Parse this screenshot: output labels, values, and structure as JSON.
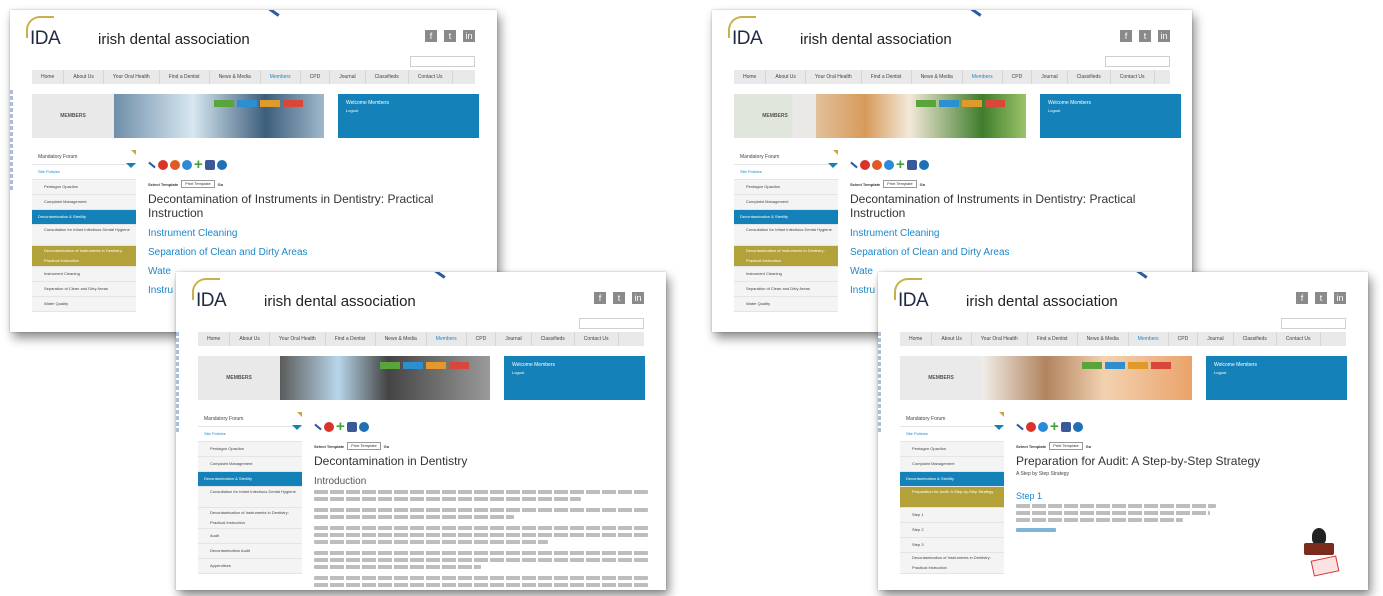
{
  "screens": [
    {
      "logo": "IDA",
      "site_name": "irish dental association",
      "nav": [
        "Home",
        "About Us",
        "Your Oral Health",
        "Find a Dentist",
        "News & Media",
        "Members",
        "CPD",
        "Journal",
        "Classifieds",
        "Contact Us"
      ],
      "banner_label": "MEMBERS",
      "welcome": "Welcome Members",
      "welcome_sub": "Logout",
      "sidebar": [
        "Mandatory Forum",
        "Site Policies",
        "Pentagon Opaclion",
        "Complaint Management",
        "Decontamination & Sterility",
        "Consultation for Infant Infectious Dental Hygiene",
        "Decontamination of Instruments in Dentistry: Practical Instruction",
        "Instrument Cleaning",
        "Separation of Clean and Dirty Areas",
        "Water Quality"
      ],
      "select_label": "Select Template",
      "select_value": "Print Template",
      "select_go": "Go",
      "title": "Decontamination of Instruments in Dentistry: Practical Instruction",
      "links": [
        "Instrument Cleaning",
        "Separation of Clean and Dirty Areas",
        "Wate",
        "Instru"
      ]
    },
    {
      "logo": "IDA",
      "site_name": "irish dental association",
      "nav": [
        "Home",
        "About Us",
        "Your Oral Health",
        "Find a Dentist",
        "News & Media",
        "Members",
        "CPD",
        "Journal",
        "Classifieds",
        "Contact Us"
      ],
      "banner_label": "MEMBERS",
      "welcome": "Welcome Members",
      "welcome_sub": "Logout",
      "sidebar": [
        "Mandatory Forum",
        "Site Policies",
        "Pentagon Opaclion",
        "Complaint Management",
        "Decontamination & Sterility",
        "Consultation for Infant Infectious Dental Hygiene",
        "Decontamination of Instruments in Dentistry: Practical Instruction",
        "Audit",
        "Decontamination Audit",
        "Appendices"
      ],
      "select_label": "Select Template",
      "select_value": "Print Template",
      "select_go": "Go",
      "title": "Decontamination in Dentistry",
      "heading": "Introduction"
    },
    {
      "logo": "IDA",
      "site_name": "irish dental association",
      "nav": [
        "Home",
        "About Us",
        "Your Oral Health",
        "Find a Dentist",
        "News & Media",
        "Members",
        "CPD",
        "Journal",
        "Classifieds",
        "Contact Us"
      ],
      "banner_label": "MEMBERS",
      "welcome": "Welcome Members",
      "welcome_sub": "Logout",
      "sidebar": [
        "Mandatory Forum",
        "Site Policies",
        "Pentagon Opaclion",
        "Complaint Management",
        "Decontamination & Sterility",
        "Consultation for Infant Infectious Dental Hygiene",
        "Decontamination of Instruments in Dentistry: Practical Instruction",
        "Instrument Cleaning",
        "Separation of Clean and Dirty Areas",
        "Water Quality"
      ],
      "select_label": "Select Template",
      "select_value": "Print Template",
      "select_go": "Go",
      "title": "Decontamination of Instruments in Dentistry: Practical Instruction",
      "links": [
        "Instrument Cleaning",
        "Separation of Clean and Dirty Areas",
        "Wate",
        "Instru"
      ]
    },
    {
      "logo": "IDA",
      "site_name": "irish dental association",
      "nav": [
        "Home",
        "About Us",
        "Your Oral Health",
        "Find a Dentist",
        "News & Media",
        "Members",
        "CPD",
        "Journal",
        "Classifieds",
        "Contact Us"
      ],
      "banner_label": "MEMBERS",
      "welcome": "Welcome Members",
      "welcome_sub": "Logout",
      "sidebar": [
        "Mandatory Forum",
        "Site Policies",
        "Pentagon Opaclion",
        "Complaint Management",
        "Decontamination & Sterility",
        "Preparation for Audit: A Step-by-Step Strategy",
        "Step 1",
        "Step 2",
        "Step 3",
        "Decontamination of Instruments in Dentistry: Practical Instruction"
      ],
      "select_label": "Select Template",
      "select_value": "Print Template",
      "select_go": "Go",
      "title": "Preparation for Audit: A Step-by-Step Strategy",
      "subtitle": "A Step by Step Strategy",
      "heading": "Step 1"
    }
  ]
}
